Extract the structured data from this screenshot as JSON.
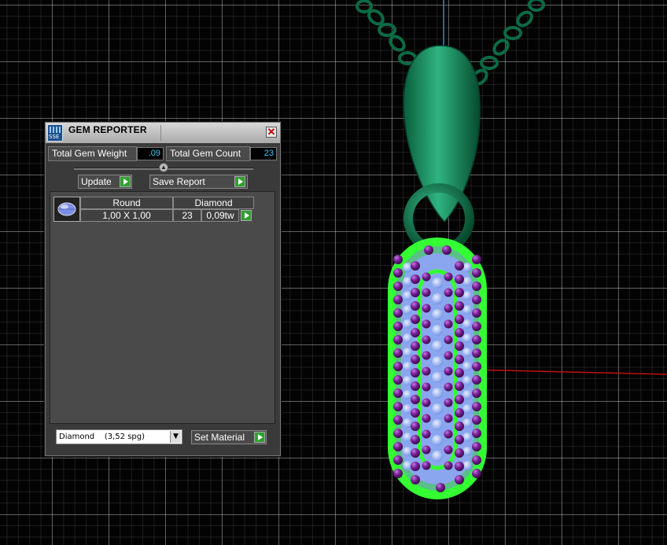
{
  "panel": {
    "title": "GEM REPORTER",
    "app_icon_label": "SSE",
    "close_glyph": "✕",
    "total_gem_weight_label": "Total Gem Weight",
    "total_gem_weight_value": ".09",
    "total_gem_count_label": "Total Gem Count",
    "total_gem_count_value": "23",
    "update_label": "Update",
    "save_report_label": "Save Report",
    "table": {
      "headers": [
        "Round",
        "Diamond"
      ],
      "rows": [
        {
          "size": "1,00 X 1,00",
          "count": "23",
          "weight": "0,09tw",
          "icon": "round-gem-icon"
        }
      ]
    },
    "material_value": "Diamond    (3,52 spg)",
    "material_arrow": "▼",
    "set_material_label": "Set Material"
  },
  "colors": {
    "pendant_green": "#0e7a4e",
    "highlight_green": "#33ff33",
    "gem_purple": "#7a1f96",
    "gem_blue": "#8fb3ff",
    "value_text": "#33ccff"
  }
}
